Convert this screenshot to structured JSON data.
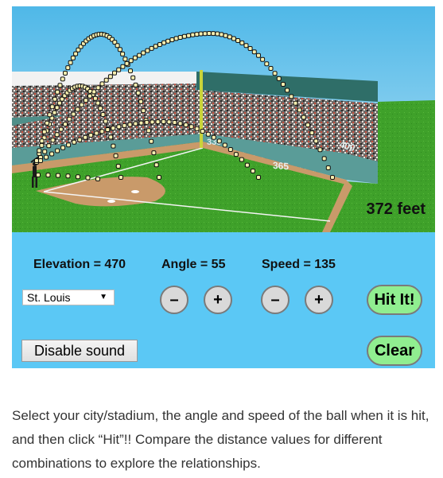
{
  "field": {
    "distance_readout": "372 feet",
    "wall_markers": [
      "335",
      "365",
      "400"
    ],
    "ball_color": "#f7efb0",
    "trajectories": [
      {
        "name": "line-drive",
        "kind": "line"
      },
      {
        "name": "small-arc",
        "kind": "arc"
      },
      {
        "name": "tall-arc",
        "kind": "arc"
      },
      {
        "name": "long-arc",
        "kind": "arc"
      },
      {
        "name": "flat-arc",
        "kind": "arc"
      }
    ]
  },
  "controls": {
    "elevation_label": "Elevation = 470",
    "angle_label": "Angle = 55",
    "speed_label": "Speed = 135",
    "city_select": {
      "selected": "St. Louis",
      "caret": "▼"
    },
    "angle_minus": "–",
    "angle_plus": "+",
    "speed_minus": "–",
    "speed_plus": "+",
    "hit_button": "Hit It!",
    "clear_button": "Clear",
    "sound_button": "Disable sound"
  },
  "colors": {
    "panel_bg": "#5bc8f5",
    "action_button_bg": "#90ee90",
    "stepper_bg": "#d9d9d9",
    "sky": "#62c2ec",
    "grass": "#3fa12a",
    "infield_dirt": "#c99a6a",
    "wall": "#5a9c98",
    "foul_pole": "#c9d43a"
  },
  "description": "Select your city/stadium, the angle and speed of the ball when it is hit, and then click “Hit”!! Compare the distance values for different combinations to explore the relationships."
}
